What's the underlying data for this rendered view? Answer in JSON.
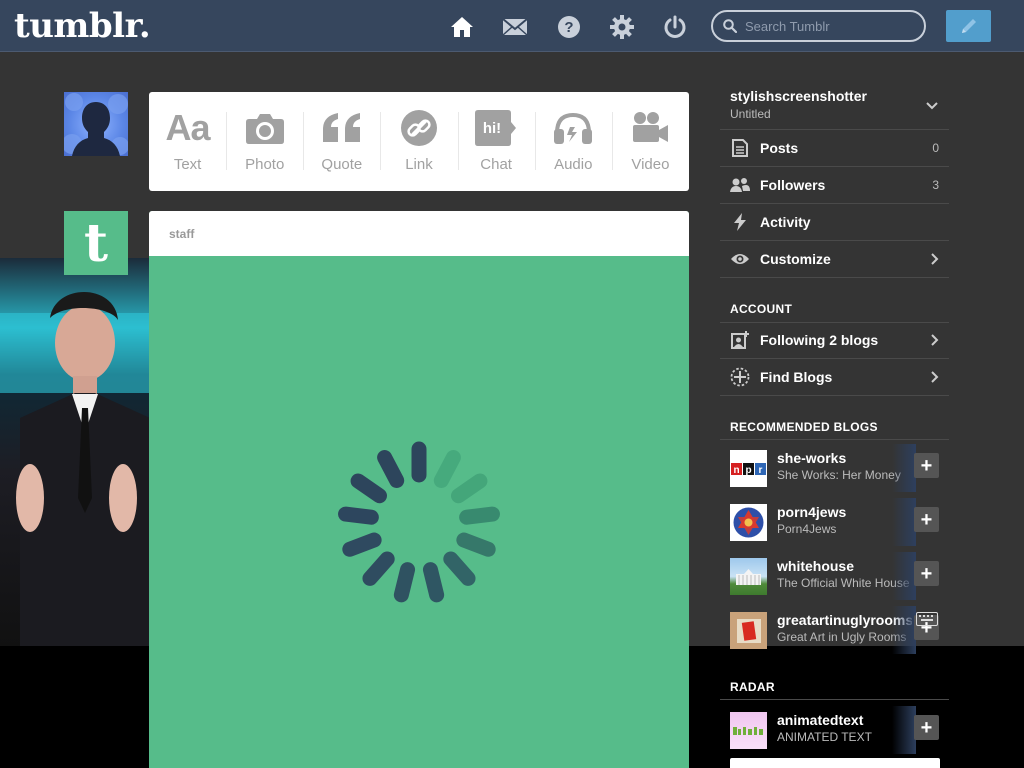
{
  "nav": {
    "logo": "tumblr.",
    "search_placeholder": "Search Tumblr",
    "icons": [
      "home-icon",
      "mail-icon",
      "help-icon",
      "settings-icon",
      "power-icon"
    ]
  },
  "post_types": [
    {
      "label": "Text",
      "icon": "text-aa-icon"
    },
    {
      "label": "Photo",
      "icon": "camera-icon"
    },
    {
      "label": "Quote",
      "icon": "quote-icon"
    },
    {
      "label": "Link",
      "icon": "link-icon"
    },
    {
      "label": "Chat",
      "icon": "chat-icon",
      "glyph": "hi!"
    },
    {
      "label": "Audio",
      "icon": "headphones-icon"
    },
    {
      "label": "Video",
      "icon": "video-camera-icon"
    }
  ],
  "post": {
    "author": "staff",
    "staff_glyph": "t"
  },
  "sidebar": {
    "blog_name": "stylishscreenshotter",
    "blog_subtitle": "Untitled",
    "items": [
      {
        "label": "Posts",
        "count": "0"
      },
      {
        "label": "Followers",
        "count": "3"
      },
      {
        "label": "Activity",
        "count": ""
      },
      {
        "label": "Customize",
        "count": ""
      }
    ],
    "account_title": "ACCOUNT",
    "account_items": [
      {
        "label": "Following 2 blogs"
      },
      {
        "label": "Find Blogs"
      }
    ],
    "recommended_title": "RECOMMENDED BLOGS",
    "recommended": [
      {
        "name": "she-works",
        "desc": "She Works: Her Money"
      },
      {
        "name": "porn4jews",
        "desc": "Porn4Jews"
      },
      {
        "name": "whitehouse",
        "desc": "The Official White House"
      },
      {
        "name": "greatartinuglyrooms",
        "desc": "Great Art in Ugly Rooms"
      }
    ],
    "radar_title": "RADAR",
    "radar": {
      "name": "animatedtext",
      "desc": "ANIMATED TEXT"
    },
    "plus_label": "+",
    "npr_logo": "npr"
  },
  "colors": {
    "nav_bg": "#36465d",
    "page_bg": "#343434",
    "post_green": "#56bc8a",
    "compose_blue": "#529ecc"
  }
}
